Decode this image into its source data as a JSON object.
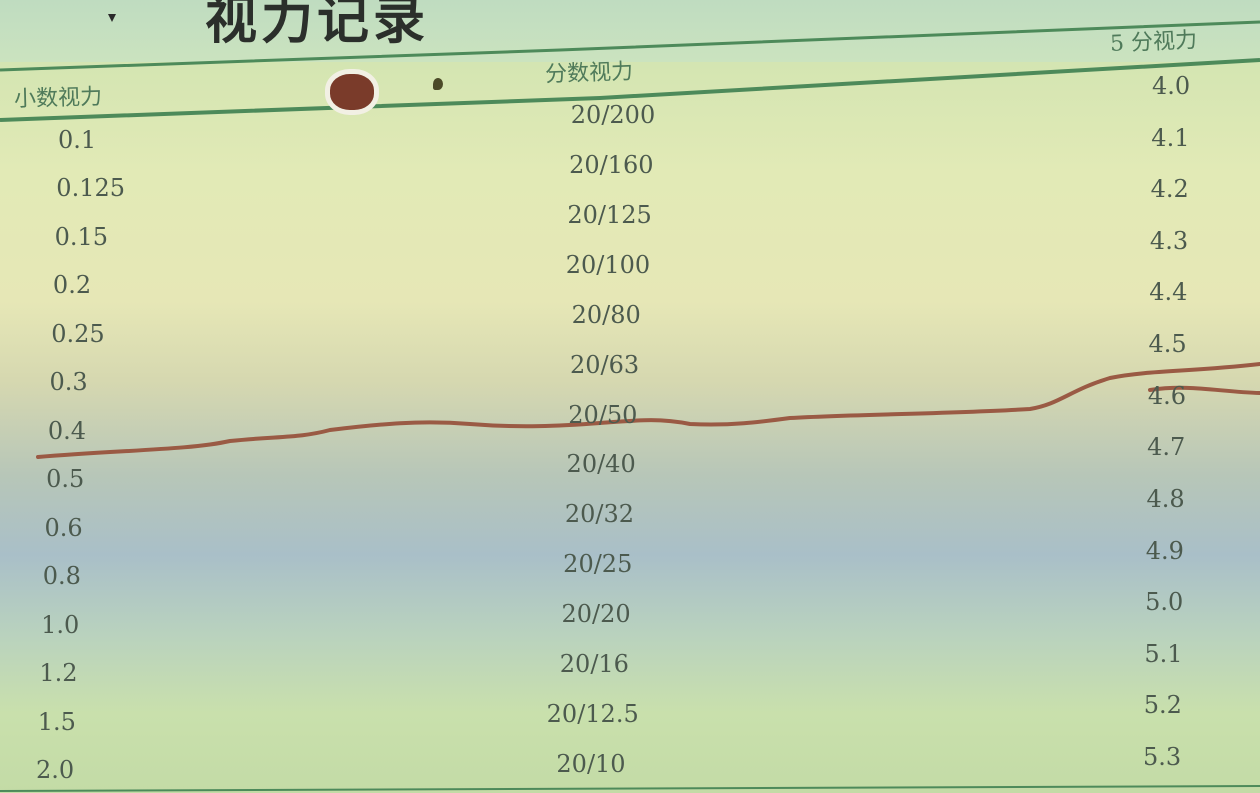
{
  "title": "视力记录         ",
  "headers": {
    "decimal": "小数视力",
    "fraction": "分数视力",
    "five_point": "5 分视力"
  },
  "rows": [
    {
      "decimal": "0.1",
      "fraction": "20/200",
      "five_point": "4.0"
    },
    {
      "decimal": "0.125",
      "fraction": "20/160",
      "five_point": "4.1"
    },
    {
      "decimal": "0.15",
      "fraction": "20/125",
      "five_point": "4.2"
    },
    {
      "decimal": "0.2",
      "fraction": "20/100",
      "five_point": "4.3"
    },
    {
      "decimal": "0.25",
      "fraction": "20/80",
      "five_point": "4.4"
    },
    {
      "decimal": "0.3",
      "fraction": "20/63",
      "five_point": "4.5"
    },
    {
      "decimal": "0.4",
      "fraction": "20/50",
      "five_point": "4.6"
    },
    {
      "decimal": "0.5",
      "fraction": "20/40",
      "five_point": "4.7"
    },
    {
      "decimal": "0.6",
      "fraction": "20/32",
      "five_point": "4.8"
    },
    {
      "decimal": "0.8",
      "fraction": "20/25",
      "five_point": "4.9"
    },
    {
      "decimal": "1.0",
      "fraction": "20/20",
      "five_point": "5.0"
    },
    {
      "decimal": "1.2",
      "fraction": "20/16",
      "five_point": "5.1"
    },
    {
      "decimal": "1.5",
      "fraction": "20/12.5",
      "five_point": "5.2"
    },
    {
      "decimal": "2.0",
      "fraction": "20/10",
      "five_point": "5.3"
    }
  ],
  "colors": {
    "rule": "#4d8a5a",
    "header_text": "#4f7a5a",
    "cell_text": "#4c5a4e",
    "marker_line": "#9a5a44"
  }
}
